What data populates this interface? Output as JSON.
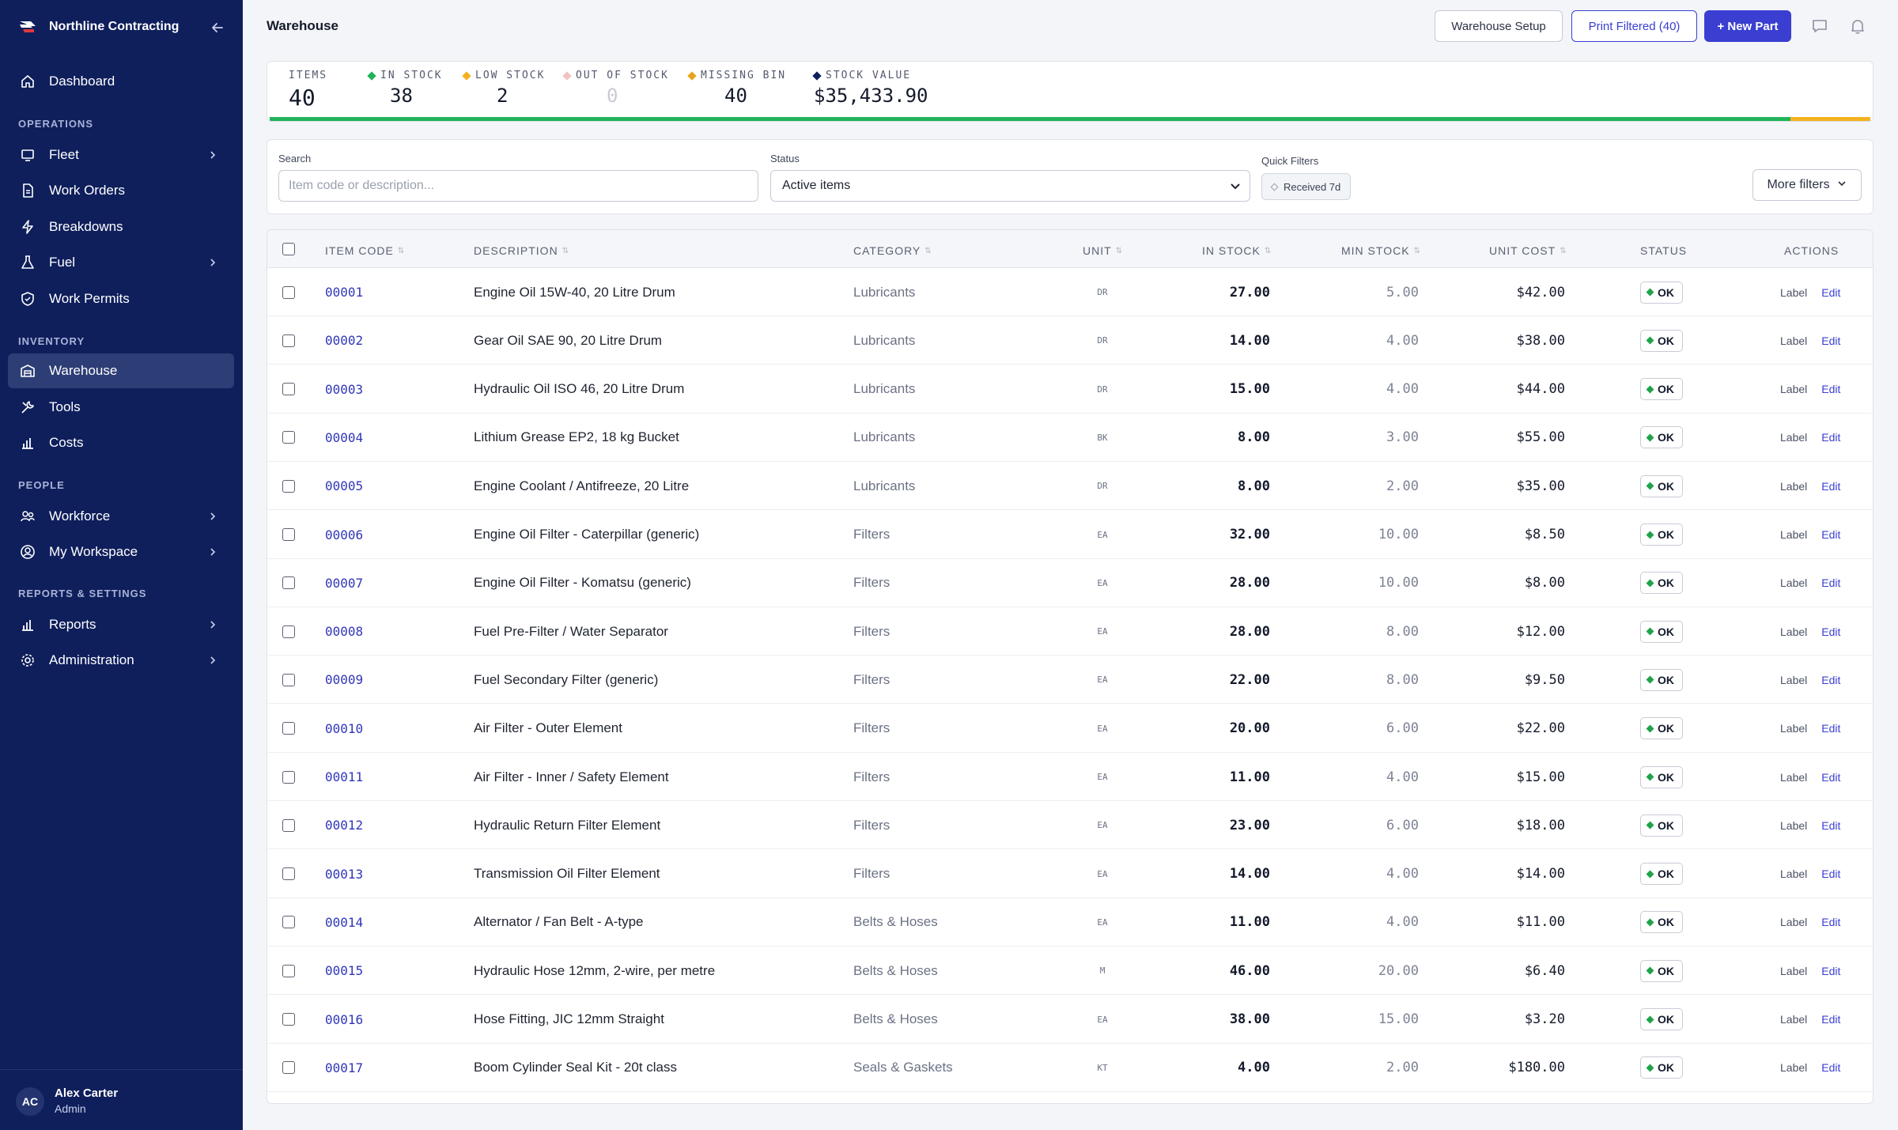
{
  "brand": {
    "name": "Northline Contracting"
  },
  "nav": {
    "dashboard": "Dashboard",
    "sections": {
      "operations": "OPERATIONS",
      "inventory": "INVENTORY",
      "people": "PEOPLE",
      "reports": "REPORTS & SETTINGS"
    },
    "fleet": "Fleet",
    "work_orders": "Work Orders",
    "breakdowns": "Breakdowns",
    "fuel": "Fuel",
    "work_permits": "Work Permits",
    "warehouse": "Warehouse",
    "tools": "Tools",
    "costs": "Costs",
    "workforce": "Workforce",
    "my_workspace": "My Workspace",
    "reports": "Reports",
    "administration": "Administration"
  },
  "user": {
    "initials": "AC",
    "name": "Alex Carter",
    "role": "Admin"
  },
  "header": {
    "title": "Warehouse",
    "setup_label": "Warehouse Setup",
    "print_label": "Print Filtered (40)",
    "new_label": "+ New Part"
  },
  "stats": {
    "items": {
      "label": "ITEMS",
      "value": "40"
    },
    "in_stock": {
      "label": "IN STOCK",
      "value": "38"
    },
    "low_stock": {
      "label": "LOW STOCK",
      "value": "2"
    },
    "out_of_stock": {
      "label": "OUT OF STOCK",
      "value": "0"
    },
    "missing_bin": {
      "label": "MISSING BIN",
      "value": "40"
    },
    "stock_value": {
      "label": "STOCK VALUE",
      "value": "$35,433.90"
    },
    "bar_in_stock_fraction": 0.95,
    "bar_low_stock_fraction": 0.05
  },
  "colors": {
    "in_stock": "#22b35a",
    "low_stock": "#f2b11f",
    "out_of_stock": "#f0c2c2",
    "missing_bin": "#e9a21e",
    "stock_value": "#0f1f5c",
    "accent": "#3a3fd1",
    "sidebar": "#0f1f5c"
  },
  "filters": {
    "search_label": "Search",
    "search_placeholder": "Item code or description...",
    "status_label": "Status",
    "status_value": "Active items",
    "quick_label": "Quick Filters",
    "quick_chip": "Received 7d",
    "more_label": "More filters"
  },
  "table": {
    "columns": {
      "code": "ITEM CODE",
      "description": "DESCRIPTION",
      "category": "CATEGORY",
      "unit": "UNIT",
      "in_stock": "IN STOCK",
      "min_stock": "MIN STOCK",
      "unit_cost": "UNIT COST",
      "status": "STATUS",
      "actions": "ACTIONS"
    },
    "action_label": "Label",
    "action_edit": "Edit",
    "rows": [
      {
        "code": "00001",
        "description": "Engine Oil 15W-40, 20 Litre Drum",
        "category": "Lubricants",
        "unit": "DR",
        "in_stock": "27.00",
        "min_stock": "5.00",
        "unit_cost": "$42.00",
        "status": "OK"
      },
      {
        "code": "00002",
        "description": "Gear Oil SAE 90, 20 Litre Drum",
        "category": "Lubricants",
        "unit": "DR",
        "in_stock": "14.00",
        "min_stock": "4.00",
        "unit_cost": "$38.00",
        "status": "OK"
      },
      {
        "code": "00003",
        "description": "Hydraulic Oil ISO 46, 20 Litre Drum",
        "category": "Lubricants",
        "unit": "DR",
        "in_stock": "15.00",
        "min_stock": "4.00",
        "unit_cost": "$44.00",
        "status": "OK"
      },
      {
        "code": "00004",
        "description": "Lithium Grease EP2, 18 kg Bucket",
        "category": "Lubricants",
        "unit": "BK",
        "in_stock": "8.00",
        "min_stock": "3.00",
        "unit_cost": "$55.00",
        "status": "OK"
      },
      {
        "code": "00005",
        "description": "Engine Coolant / Antifreeze, 20 Litre",
        "category": "Lubricants",
        "unit": "DR",
        "in_stock": "8.00",
        "min_stock": "2.00",
        "unit_cost": "$35.00",
        "status": "OK"
      },
      {
        "code": "00006",
        "description": "Engine Oil Filter - Caterpillar (generic)",
        "category": "Filters",
        "unit": "EA",
        "in_stock": "32.00",
        "min_stock": "10.00",
        "unit_cost": "$8.50",
        "status": "OK"
      },
      {
        "code": "00007",
        "description": "Engine Oil Filter - Komatsu (generic)",
        "category": "Filters",
        "unit": "EA",
        "in_stock": "28.00",
        "min_stock": "10.00",
        "unit_cost": "$8.00",
        "status": "OK"
      },
      {
        "code": "00008",
        "description": "Fuel Pre-Filter / Water Separator",
        "category": "Filters",
        "unit": "EA",
        "in_stock": "28.00",
        "min_stock": "8.00",
        "unit_cost": "$12.00",
        "status": "OK"
      },
      {
        "code": "00009",
        "description": "Fuel Secondary Filter (generic)",
        "category": "Filters",
        "unit": "EA",
        "in_stock": "22.00",
        "min_stock": "8.00",
        "unit_cost": "$9.50",
        "status": "OK"
      },
      {
        "code": "00010",
        "description": "Air Filter - Outer Element",
        "category": "Filters",
        "unit": "EA",
        "in_stock": "20.00",
        "min_stock": "6.00",
        "unit_cost": "$22.00",
        "status": "OK"
      },
      {
        "code": "00011",
        "description": "Air Filter - Inner / Safety Element",
        "category": "Filters",
        "unit": "EA",
        "in_stock": "11.00",
        "min_stock": "4.00",
        "unit_cost": "$15.00",
        "status": "OK"
      },
      {
        "code": "00012",
        "description": "Hydraulic Return Filter Element",
        "category": "Filters",
        "unit": "EA",
        "in_stock": "23.00",
        "min_stock": "6.00",
        "unit_cost": "$18.00",
        "status": "OK"
      },
      {
        "code": "00013",
        "description": "Transmission Oil Filter Element",
        "category": "Filters",
        "unit": "EA",
        "in_stock": "14.00",
        "min_stock": "4.00",
        "unit_cost": "$14.00",
        "status": "OK"
      },
      {
        "code": "00014",
        "description": "Alternator / Fan Belt - A-type",
        "category": "Belts & Hoses",
        "unit": "EA",
        "in_stock": "11.00",
        "min_stock": "4.00",
        "unit_cost": "$11.00",
        "status": "OK"
      },
      {
        "code": "00015",
        "description": "Hydraulic Hose 12mm, 2-wire, per metre",
        "category": "Belts & Hoses",
        "unit": "M",
        "in_stock": "46.00",
        "min_stock": "20.00",
        "unit_cost": "$6.40",
        "status": "OK"
      },
      {
        "code": "00016",
        "description": "Hose Fitting, JIC 12mm Straight",
        "category": "Belts & Hoses",
        "unit": "EA",
        "in_stock": "38.00",
        "min_stock": "15.00",
        "unit_cost": "$3.20",
        "status": "OK"
      },
      {
        "code": "00017",
        "description": "Boom Cylinder Seal Kit - 20t class",
        "category": "Seals & Gaskets",
        "unit": "KT",
        "in_stock": "4.00",
        "min_stock": "2.00",
        "unit_cost": "$180.00",
        "status": "OK"
      }
    ]
  }
}
